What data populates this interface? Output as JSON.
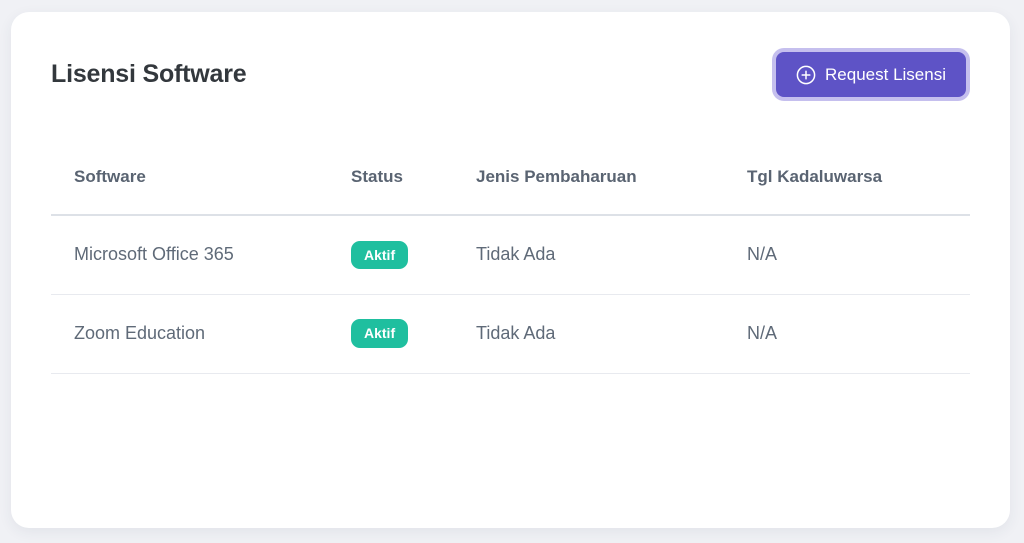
{
  "page": {
    "background_color": "#f0f1f5"
  },
  "card": {
    "title": "Lisensi Software",
    "request_button": {
      "label": "Request Lisensi",
      "icon": "plus-circle-icon",
      "background_color": "#5e53c6",
      "ring_color": "#c5bfee"
    },
    "table": {
      "columns": [
        "Software",
        "Status",
        "Jenis Pembaharuan",
        "Tgl Kadaluwarsa"
      ],
      "rows": [
        {
          "software": "Microsoft Office 365",
          "status": "Aktif",
          "status_color": "#1fbf9f",
          "jenis_pembaharuan": "Tidak Ada",
          "tgl_kadaluwarsa": "N/A"
        },
        {
          "software": "Zoom Education",
          "status": "Aktif",
          "status_color": "#1fbf9f",
          "jenis_pembaharuan": "Tidak Ada",
          "tgl_kadaluwarsa": "N/A"
        }
      ]
    }
  }
}
